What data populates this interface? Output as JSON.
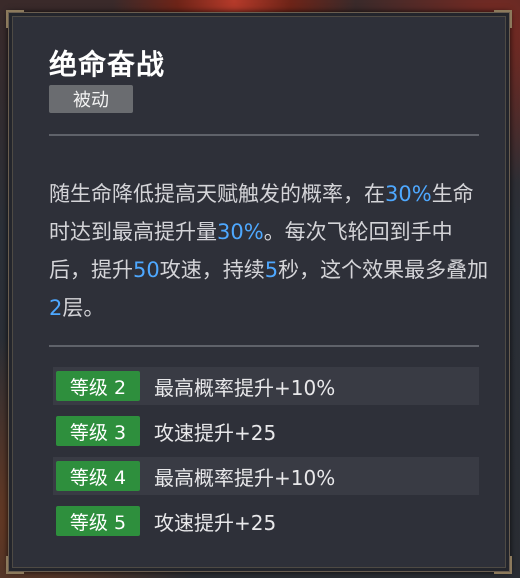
{
  "skill": {
    "title": "绝命奋战",
    "tag": "被动",
    "description_parts": [
      {
        "text": "随生命降低提高天赋触发的概率，在",
        "highlight": false
      },
      {
        "text": "30%",
        "highlight": true
      },
      {
        "text": "生命时达到最高提升量",
        "highlight": false
      },
      {
        "text": "30%",
        "highlight": true
      },
      {
        "text": "。每次飞轮回到手中后，提升",
        "highlight": false
      },
      {
        "text": "50",
        "highlight": true
      },
      {
        "text": "攻速，持续",
        "highlight": false
      },
      {
        "text": "5",
        "highlight": true
      },
      {
        "text": "秒，这个效果最多叠加",
        "highlight": false
      },
      {
        "text": "2",
        "highlight": true
      },
      {
        "text": "层。",
        "highlight": false
      }
    ],
    "levels": [
      {
        "label": "等级 2",
        "effect": "最高概率提升+10%"
      },
      {
        "label": "等级 3",
        "effect": "攻速提升+25"
      },
      {
        "label": "等级 4",
        "effect": "最高概率提升+10%"
      },
      {
        "label": "等级 5",
        "effect": "攻速提升+25"
      }
    ]
  },
  "colors": {
    "highlight": "#4ea8ff",
    "level_badge": "#2e8f3d",
    "panel_bg": "#2e3039"
  }
}
